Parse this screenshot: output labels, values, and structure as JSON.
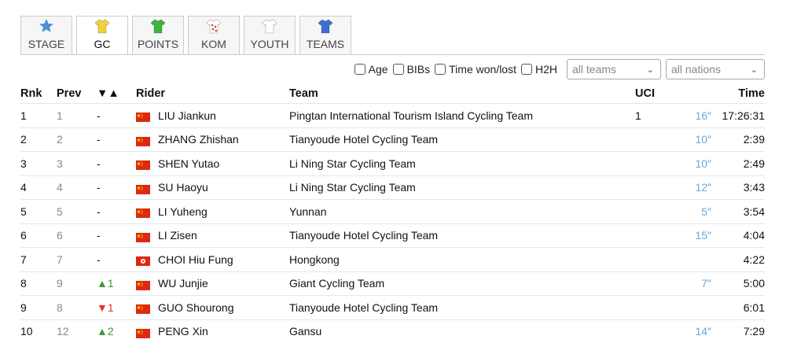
{
  "tabs": [
    {
      "label": "STAGE",
      "icon": "star-icon",
      "color": "#4a90d9",
      "active": false
    },
    {
      "label": "GC",
      "icon": "yellow-jersey-icon",
      "color": "#f0d23c",
      "active": true
    },
    {
      "label": "POINTS",
      "icon": "green-jersey-icon",
      "color": "#3cb43c",
      "active": false
    },
    {
      "label": "KOM",
      "icon": "polka-dot-jersey-icon",
      "color": "#d23c3c",
      "active": false
    },
    {
      "label": "YOUTH",
      "icon": "white-jersey-icon",
      "color": "#ffffff",
      "active": false
    },
    {
      "label": "TEAMS",
      "icon": "blue-jersey-icon",
      "color": "#3c6ed2",
      "active": false
    }
  ],
  "filters": {
    "checkboxes": [
      "Age",
      "BIBs",
      "Time won/lost",
      "H2H"
    ],
    "teams_select": "all teams",
    "nations_select": "all nations"
  },
  "headers": {
    "rnk": "Rnk",
    "prev": "Prev",
    "change": "▼▲",
    "rider": "Rider",
    "team": "Team",
    "uci": "UCI",
    "time": "Time"
  },
  "rows": [
    {
      "rnk": "1",
      "prev": "1",
      "change": "-",
      "dir": "",
      "flag": "cn",
      "rider": "LIU Jiankun",
      "team": "Pingtan International Tourism Island Cycling Team",
      "uci": "1",
      "bonus": "16″",
      "time": "17:26:31"
    },
    {
      "rnk": "2",
      "prev": "2",
      "change": "-",
      "dir": "",
      "flag": "cn",
      "rider": "ZHANG Zhishan",
      "team": "Tianyoude Hotel Cycling Team",
      "uci": "",
      "bonus": "10″",
      "time": "2:39"
    },
    {
      "rnk": "3",
      "prev": "3",
      "change": "-",
      "dir": "",
      "flag": "cn",
      "rider": "SHEN Yutao",
      "team": "Li Ning Star Cycling Team",
      "uci": "",
      "bonus": "10″",
      "time": "2:49"
    },
    {
      "rnk": "4",
      "prev": "4",
      "change": "-",
      "dir": "",
      "flag": "cn",
      "rider": "SU Haoyu",
      "team": "Li Ning Star Cycling Team",
      "uci": "",
      "bonus": "12″",
      "time": "3:43"
    },
    {
      "rnk": "5",
      "prev": "5",
      "change": "-",
      "dir": "",
      "flag": "cn",
      "rider": "LI Yuheng",
      "team": "Yunnan",
      "uci": "",
      "bonus": "5″",
      "time": "3:54"
    },
    {
      "rnk": "6",
      "prev": "6",
      "change": "-",
      "dir": "",
      "flag": "cn",
      "rider": "LI Zisen",
      "team": "Tianyoude Hotel Cycling Team",
      "uci": "",
      "bonus": "15″",
      "time": "4:04"
    },
    {
      "rnk": "7",
      "prev": "7",
      "change": "-",
      "dir": "",
      "flag": "hk",
      "rider": "CHOI Hiu Fung",
      "team": "Hongkong",
      "uci": "",
      "bonus": "",
      "time": "4:22"
    },
    {
      "rnk": "8",
      "prev": "9",
      "change": "▲1",
      "dir": "up",
      "flag": "cn",
      "rider": "WU Junjie",
      "team": "Giant Cycling Team",
      "uci": "",
      "bonus": "7″",
      "time": "5:00"
    },
    {
      "rnk": "9",
      "prev": "8",
      "change": "▼1",
      "dir": "down",
      "flag": "cn",
      "rider": "GUO Shourong",
      "team": "Tianyoude Hotel Cycling Team",
      "uci": "",
      "bonus": "",
      "time": "6:01"
    },
    {
      "rnk": "10",
      "prev": "12",
      "change": "▲2",
      "dir": "up",
      "flag": "cn",
      "rider": "PENG Xin",
      "team": "Gansu",
      "uci": "",
      "bonus": "14″",
      "time": "7:29"
    }
  ]
}
